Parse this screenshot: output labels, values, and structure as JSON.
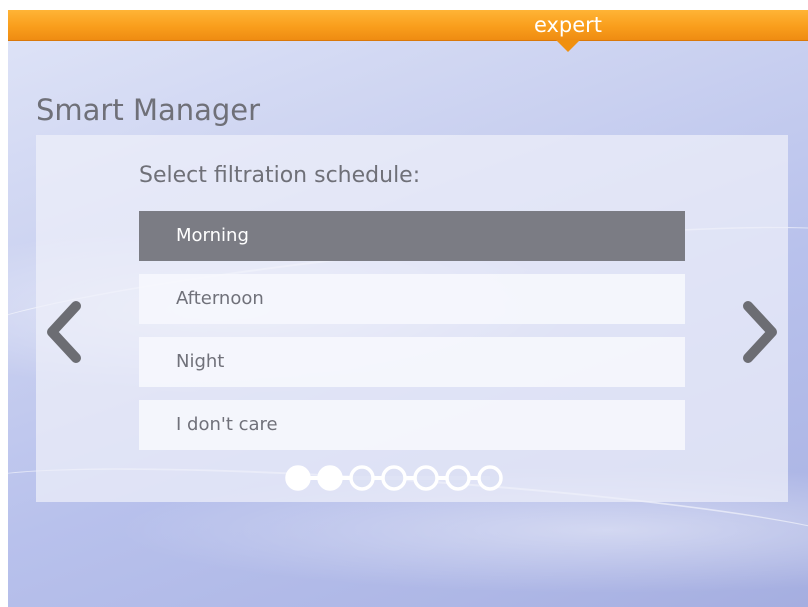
{
  "header": {
    "mode_label": "expert"
  },
  "page": {
    "title": "Smart Manager"
  },
  "panel": {
    "prompt": "Select filtration schedule:",
    "options": [
      {
        "label": "Morning",
        "selected": true
      },
      {
        "label": "Afternoon",
        "selected": false
      },
      {
        "label": "Night",
        "selected": false
      },
      {
        "label": "I don't care",
        "selected": false
      }
    ],
    "pagination": {
      "total_steps": 7,
      "completed_steps": 2
    }
  },
  "icons": {
    "prev": "chevron-left-icon",
    "next": "chevron-right-icon"
  },
  "colors": {
    "accent_orange": "#f99e1c",
    "selected_option": "#7b7c84",
    "text_gray": "#6f7078"
  }
}
